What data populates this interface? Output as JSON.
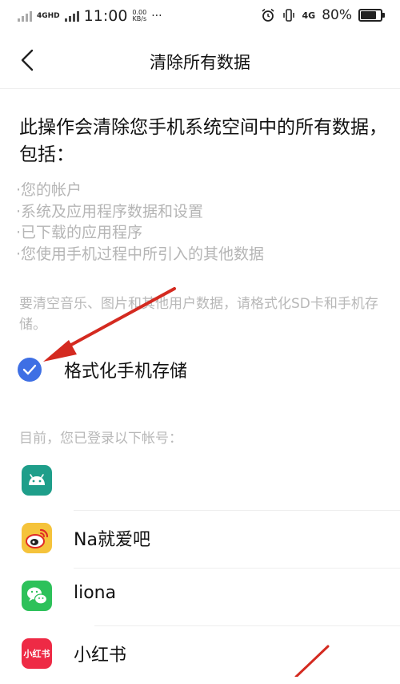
{
  "status_bar": {
    "network": "4GHD",
    "time": "11:00",
    "speed_value": "0.00",
    "speed_unit": "KB/s",
    "more": "···",
    "net2": "4G",
    "battery": "80%",
    "battery_level": 0.8
  },
  "nav": {
    "title": "清除所有数据"
  },
  "content": {
    "warning": "此操作会清除您手机系统空间中的所有数据，包括：",
    "items": [
      "·您的帐户",
      "·系统及应用程序数据和设置",
      "·已下载的应用程序",
      "·您使用手机过程中所引入的其他数据"
    ],
    "note": "要清空音乐、图片和其他用户数据，请格式化SD卡和手机存储。",
    "format_label": "格式化手机存储",
    "format_checked": true,
    "accounts_header": "目前，您已登录以下帐号："
  },
  "accounts": [
    {
      "icon": "android-icon",
      "name": "",
      "color": "#1e9e8a"
    },
    {
      "icon": "weibo-icon",
      "name": "Na就爱吧",
      "color": "#f5c33b"
    },
    {
      "icon": "wechat-icon",
      "name": "liona",
      "color": "#2dc15a"
    },
    {
      "icon": "xiaohongshu-icon",
      "name": "小红书",
      "color": "#ee2a45",
      "icon_text": "小红书"
    }
  ],
  "colors": {
    "accent": "#3e6fe4",
    "annotation_arrow": "#d42a20"
  }
}
